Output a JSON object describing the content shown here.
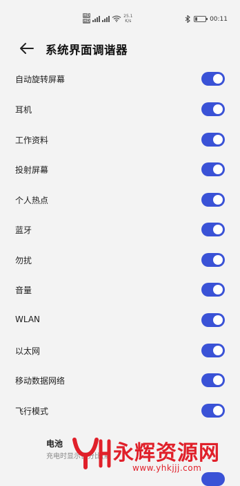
{
  "status_bar": {
    "sim1": "HD",
    "sim2": "HD",
    "net_speed_value": "25.1",
    "net_speed_unit": "K/s",
    "battery_percent": "20",
    "time": "00:11"
  },
  "header": {
    "title": "系统界面调谐器"
  },
  "items": [
    {
      "label": "自动旋转屏幕",
      "on": true
    },
    {
      "label": "耳机",
      "on": true
    },
    {
      "label": "工作资料",
      "on": true
    },
    {
      "label": "投射屏幕",
      "on": true
    },
    {
      "label": "个人热点",
      "on": true
    },
    {
      "label": "蓝牙",
      "on": true
    },
    {
      "label": "勿扰",
      "on": true
    },
    {
      "label": "音量",
      "on": true
    },
    {
      "label": "WLAN",
      "on": true
    },
    {
      "label": "以太网",
      "on": true
    },
    {
      "label": "移动数据网络",
      "on": true
    },
    {
      "label": "飞行模式",
      "on": true
    }
  ],
  "battery_item": {
    "title": "电池",
    "subtitle": "充电时显示百分比(默"
  },
  "watermark": {
    "text": "永辉资源网",
    "url": "www.yhkjjj.com"
  },
  "colors": {
    "accent": "#3a52d6",
    "background": "#f3f3f3",
    "watermark": "#e0202a"
  }
}
